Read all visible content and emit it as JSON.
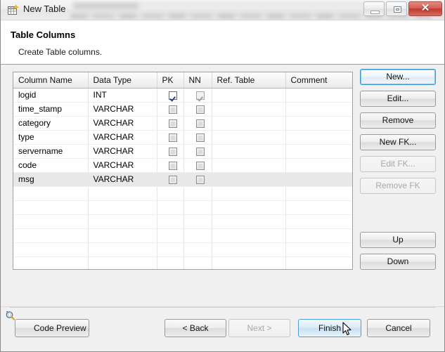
{
  "window": {
    "title": "New Table",
    "icon": "new-table-icon",
    "controls": {
      "minimize": "Minimize",
      "maximize": "Maximize",
      "close": "Close",
      "close_glyph": "✕"
    }
  },
  "header": {
    "title": "Table Columns",
    "subtitle": "Create Table columns."
  },
  "grid": {
    "columns": [
      "Column Name",
      "Data Type",
      "PK",
      "NN",
      "Ref. Table",
      "Comment"
    ],
    "rows": [
      {
        "name": "logid",
        "type": "INT",
        "pk": "checked",
        "nn": "checked-dim",
        "ref": "",
        "comment": "",
        "selected": false
      },
      {
        "name": "time_stamp",
        "type": "VARCHAR",
        "pk": "unchecked",
        "nn": "unchecked",
        "ref": "",
        "comment": "",
        "selected": false
      },
      {
        "name": "category",
        "type": "VARCHAR",
        "pk": "unchecked",
        "nn": "unchecked",
        "ref": "",
        "comment": "",
        "selected": false
      },
      {
        "name": "type",
        "type": "VARCHAR",
        "pk": "unchecked",
        "nn": "unchecked",
        "ref": "",
        "comment": "",
        "selected": false
      },
      {
        "name": "servername",
        "type": "VARCHAR",
        "pk": "unchecked",
        "nn": "unchecked",
        "ref": "",
        "comment": "",
        "selected": false
      },
      {
        "name": "code",
        "type": "VARCHAR",
        "pk": "unchecked",
        "nn": "unchecked",
        "ref": "",
        "comment": "",
        "selected": false
      },
      {
        "name": "msg",
        "type": "VARCHAR",
        "pk": "unchecked",
        "nn": "unchecked",
        "ref": "",
        "comment": "",
        "selected": true
      }
    ],
    "empty_row_count": 6
  },
  "side_buttons": [
    {
      "label": "New...",
      "state": "focused"
    },
    {
      "label": "Edit...",
      "state": "normal"
    },
    {
      "label": "Remove",
      "state": "normal"
    },
    {
      "label": "New FK...",
      "state": "normal"
    },
    {
      "label": "Edit FK...",
      "state": "disabled"
    },
    {
      "label": "Remove FK",
      "state": "disabled"
    },
    {
      "label": "Up",
      "state": "normal"
    },
    {
      "label": "Down",
      "state": "normal"
    }
  ],
  "footer": {
    "code_preview": "Code Preview",
    "code_preview_icon": "magnifier-icon",
    "back": "< Back",
    "next": "Next >",
    "finish": "Finish",
    "cancel": "Cancel"
  },
  "colors": {
    "accent_blue": "#3c99d4",
    "pk_check": "#23447e",
    "close_red": "#bf3a2c",
    "dialog_bg": "#f0f0f0"
  }
}
